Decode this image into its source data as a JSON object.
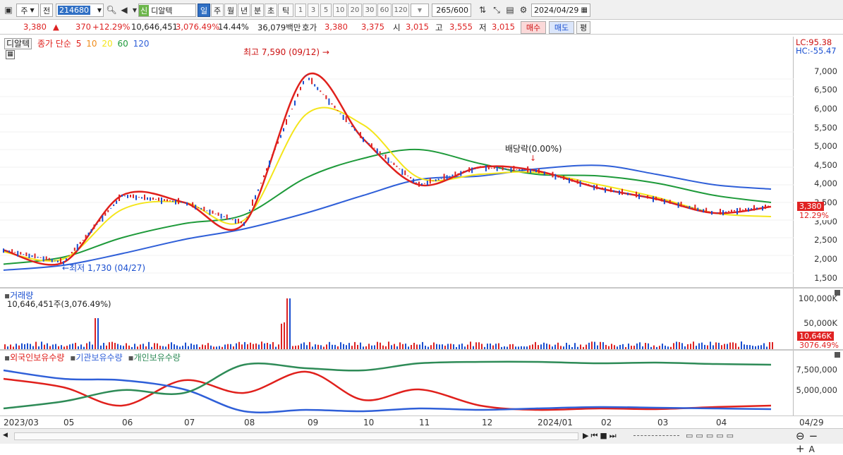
{
  "toolbar": {
    "market": "주",
    "prev": "전",
    "code": "214680",
    "name_prefix": "신",
    "name": "디알텍",
    "periods": [
      "일",
      "주",
      "월",
      "년",
      "분",
      "초",
      "틱"
    ],
    "minutes": [
      "1",
      "3",
      "5",
      "10",
      "20",
      "30",
      "60",
      "120"
    ],
    "count": "265",
    "count_max": "/600",
    "date": "2024/04/29"
  },
  "infobar": {
    "price": "3,380",
    "change": "370",
    "change_pct": "+12.29%",
    "volume": "10,646,451",
    "volume_pct": "3,076.49%",
    "turnover": "14.44%",
    "amount": "36,079백만",
    "quote_label": "호가",
    "ask": "3,380",
    "bid": "3,375",
    "open_label": "시",
    "open": "3,015",
    "high_label": "고",
    "high": "3,555",
    "low_label": "저",
    "low": "3,015",
    "buy": "매수",
    "sell": "매도",
    "flat": "평"
  },
  "price_pane": {
    "name_tag": "디알텍",
    "ma_label": "종가 단순",
    "ma_periods": [
      "5",
      "10",
      "20",
      "60",
      "120"
    ],
    "ma_colors": [
      "#e0201c",
      "#f08c1a",
      "#f4e51a",
      "#1e9a3a",
      "#2f5fd8"
    ],
    "lc": "LC:95.38",
    "hc": "HC:-55.47",
    "high_note": "최고 7,590 (09/12)",
    "low_note": "최저 1,730 (04/27)",
    "dividend_note": "배당락(0.00%)",
    "y_ticks": [
      "7,000",
      "6,500",
      "6,000",
      "5,500",
      "5,000",
      "4,500",
      "4,000",
      "3,500",
      "3,000",
      "2,500",
      "2,000",
      "1,500"
    ],
    "last_price_tag": "3,380",
    "last_pct_tag": "12.29%"
  },
  "volume_pane": {
    "title": "거래량",
    "summary": "10,646,451주(3,076.49%)",
    "y_ticks": [
      "100,000K",
      "50,000K"
    ],
    "last_tag": "10,646K",
    "last_pct_tag": "3076.49%"
  },
  "holding_pane": {
    "series": [
      "외국인보유수량",
      "기관보유수량",
      "개인보유수량"
    ],
    "series_colors": [
      "#e0201c",
      "#2f5fd8",
      "#2e8b57"
    ],
    "y_ticks": [
      "7,500,000",
      "5,000,000"
    ]
  },
  "x_labels": [
    "2023/03",
    "05",
    "06",
    "07",
    "08",
    "09",
    "10",
    "11",
    "12",
    "2024/01",
    "02",
    "03",
    "04",
    "04/29"
  ],
  "chart_data": {
    "type": "line",
    "title": "",
    "x": [
      "2023/03",
      "05",
      "06",
      "07",
      "08",
      "09",
      "10",
      "11",
      "12",
      "2024/01",
      "02",
      "03",
      "04",
      "04/29"
    ],
    "xlabel": "",
    "ylabel": "",
    "ylim": [
      1300,
      7800
    ],
    "series": [
      {
        "name": "5",
        "values": [
          2150,
          1800,
          3700,
          3500,
          2900,
          7100,
          5300,
          4000,
          4500,
          4400,
          3900,
          3600,
          3200,
          3380
        ]
      },
      {
        "name": "20",
        "values": [
          2100,
          1900,
          3300,
          3500,
          3000,
          6000,
          5700,
          4200,
          4300,
          4350,
          4000,
          3650,
          3200,
          3100
        ]
      },
      {
        "name": "60",
        "values": [
          1750,
          1950,
          2500,
          2900,
          3150,
          4200,
          4750,
          5000,
          4600,
          4300,
          4250,
          4050,
          3700,
          3500
        ]
      },
      {
        "name": "120",
        "values": [
          1580,
          1720,
          2050,
          2450,
          2750,
          3200,
          3700,
          4150,
          4250,
          4450,
          4550,
          4300,
          4000,
          3880
        ]
      }
    ],
    "annotations": [
      "최고 7,590 (09/12)",
      "최저 1,730 (04/27)",
      "배당락(0.00%)"
    ]
  }
}
